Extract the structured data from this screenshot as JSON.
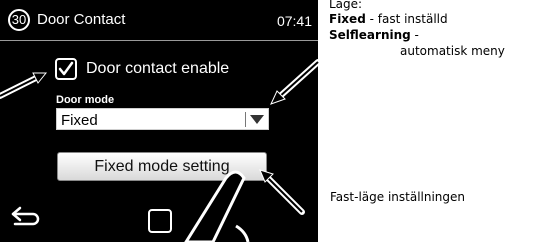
{
  "screen": {
    "number": "30",
    "title": "Door Contact",
    "time": "07:41",
    "checkbox_label": "Door contact enable",
    "checkbox_checked": true,
    "mode_label": "Door mode",
    "mode_value": "Fixed",
    "fixed_button": "Fixed mode setting"
  },
  "annotations": {
    "lage": "Läge:",
    "fixed_bold": "Fixed",
    "fixed_text": " - fast inställd",
    "self_bold": "Selflearning",
    "self_text": " -",
    "auto_text": "automatisk meny",
    "fast_lage": "Fast-läge inställningen"
  }
}
